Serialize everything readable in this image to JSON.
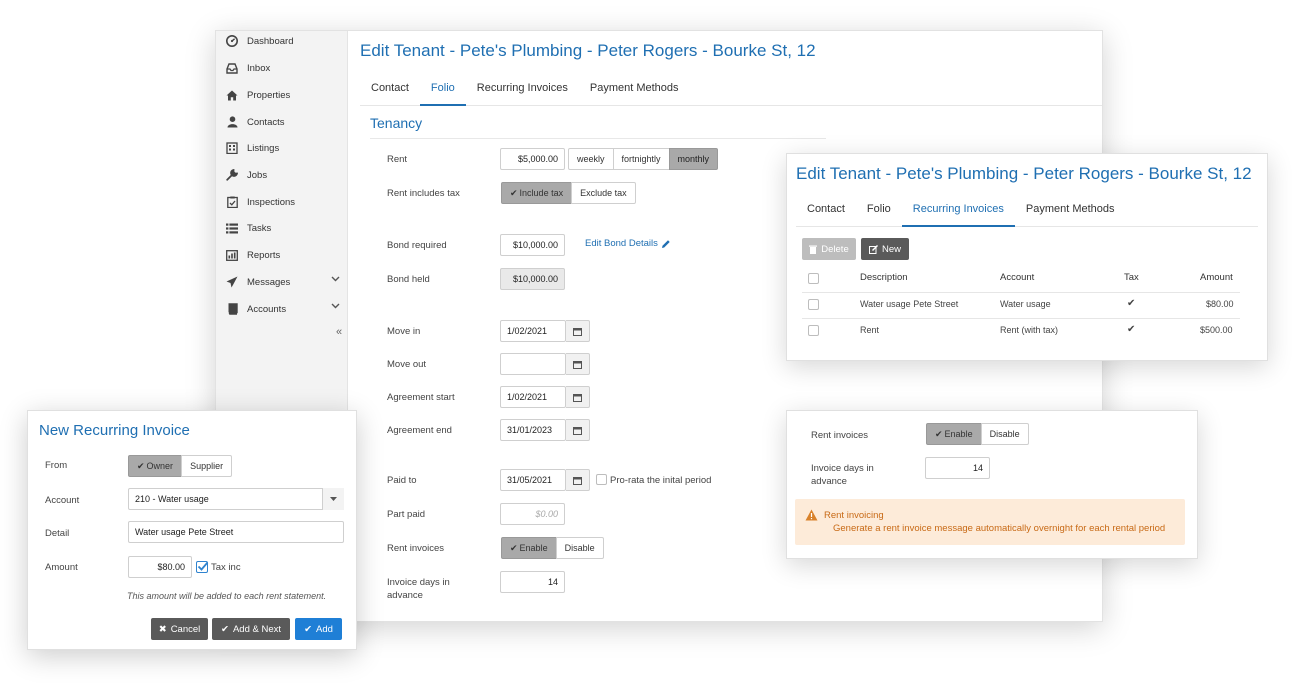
{
  "sidebar": {
    "items": [
      {
        "label": "Dashboard",
        "icon": "dashboard-icon"
      },
      {
        "label": "Inbox",
        "icon": "inbox-icon"
      },
      {
        "label": "Properties",
        "icon": "home-icon"
      },
      {
        "label": "Contacts",
        "icon": "user-icon"
      },
      {
        "label": "Listings",
        "icon": "building-icon"
      },
      {
        "label": "Jobs",
        "icon": "wrench-icon"
      },
      {
        "label": "Inspections",
        "icon": "clipboard-check-icon"
      },
      {
        "label": "Tasks",
        "icon": "list-icon"
      },
      {
        "label": "Reports",
        "icon": "reports-icon"
      },
      {
        "label": "Messages",
        "icon": "send-icon"
      },
      {
        "label": "Accounts",
        "icon": "book-icon"
      }
    ]
  },
  "main": {
    "title": "Edit Tenant - Pete's Plumbing - Peter Rogers - Bourke St, 12",
    "tabs": [
      "Contact",
      "Folio",
      "Recurring Invoices",
      "Payment Methods"
    ],
    "active_tab": "Folio",
    "section_title": "Tenancy",
    "rent": {
      "label": "Rent",
      "value": "$5,000.00",
      "options": [
        "weekly",
        "fortnightly",
        "monthly"
      ],
      "selected": "monthly"
    },
    "rent_tax": {
      "label": "Rent includes tax",
      "options": [
        "Include tax",
        "Exclude tax"
      ],
      "selected": "Include tax"
    },
    "bond_required": {
      "label": "Bond required",
      "value": "$10,000.00",
      "link": "Edit Bond Details"
    },
    "bond_held": {
      "label": "Bond held",
      "value": "$10,000.00"
    },
    "move_in": {
      "label": "Move in",
      "value": "1/02/2021"
    },
    "move_out": {
      "label": "Move out",
      "value": ""
    },
    "agreement_start": {
      "label": "Agreement start",
      "value": "1/02/2021"
    },
    "agreement_end": {
      "label": "Agreement end",
      "value": "31/01/2023"
    },
    "paid_to": {
      "label": "Paid to",
      "value": "31/05/2021",
      "pro_rata_label": "Pro-rata the inital period"
    },
    "part_paid": {
      "label": "Part paid",
      "placeholder": "$0.00"
    },
    "rent_invoices": {
      "label": "Rent invoices",
      "options": [
        "Enable",
        "Disable"
      ],
      "selected": "Enable"
    },
    "invoice_days": {
      "label": "Invoice days in advance",
      "value": "14"
    }
  },
  "recurring": {
    "title": "Edit Tenant - Pete's Plumbing - Peter Rogers - Bourke St, 12",
    "tabs": [
      "Contact",
      "Folio",
      "Recurring Invoices",
      "Payment Methods"
    ],
    "active_tab": "Recurring Invoices",
    "delete_label": "Delete",
    "new_label": "New",
    "columns": [
      "Description",
      "Account",
      "Tax",
      "Amount"
    ],
    "rows": [
      {
        "description": "Water usage Pete Street",
        "account": "Water usage",
        "tax": true,
        "amount": "$80.00"
      },
      {
        "description": "Rent",
        "account": "Rent (with tax)",
        "tax": true,
        "amount": "$500.00"
      }
    ]
  },
  "rent_panel": {
    "rent_invoices_label": "Rent invoices",
    "options": [
      "Enable",
      "Disable"
    ],
    "selected": "Enable",
    "invoice_days_label": "Invoice days in advance",
    "invoice_days_value": "14",
    "warning_title": "Rent invoicing",
    "warning_text": "Generate a rent invoice message automatically overnight for each rental period"
  },
  "new_invoice": {
    "title": "New Recurring Invoice",
    "from_label": "From",
    "from_options": [
      "Owner",
      "Supplier"
    ],
    "from_selected": "Owner",
    "account_label": "Account",
    "account_value": "210 - Water usage",
    "detail_label": "Detail",
    "detail_value": "Water usage Pete Street",
    "amount_label": "Amount",
    "amount_value": "$80.00",
    "tax_inc_label": "Tax inc",
    "tax_inc_checked": true,
    "note": "This amount will be added to each rent statement.",
    "cancel_label": "Cancel",
    "add_next_label": "Add & Next",
    "add_label": "Add"
  },
  "colors": {
    "accent": "#1f6fb2",
    "primary_button": "#1f7fd6",
    "warning_bg": "#fdebd9",
    "warning_text": "#c86a16"
  }
}
